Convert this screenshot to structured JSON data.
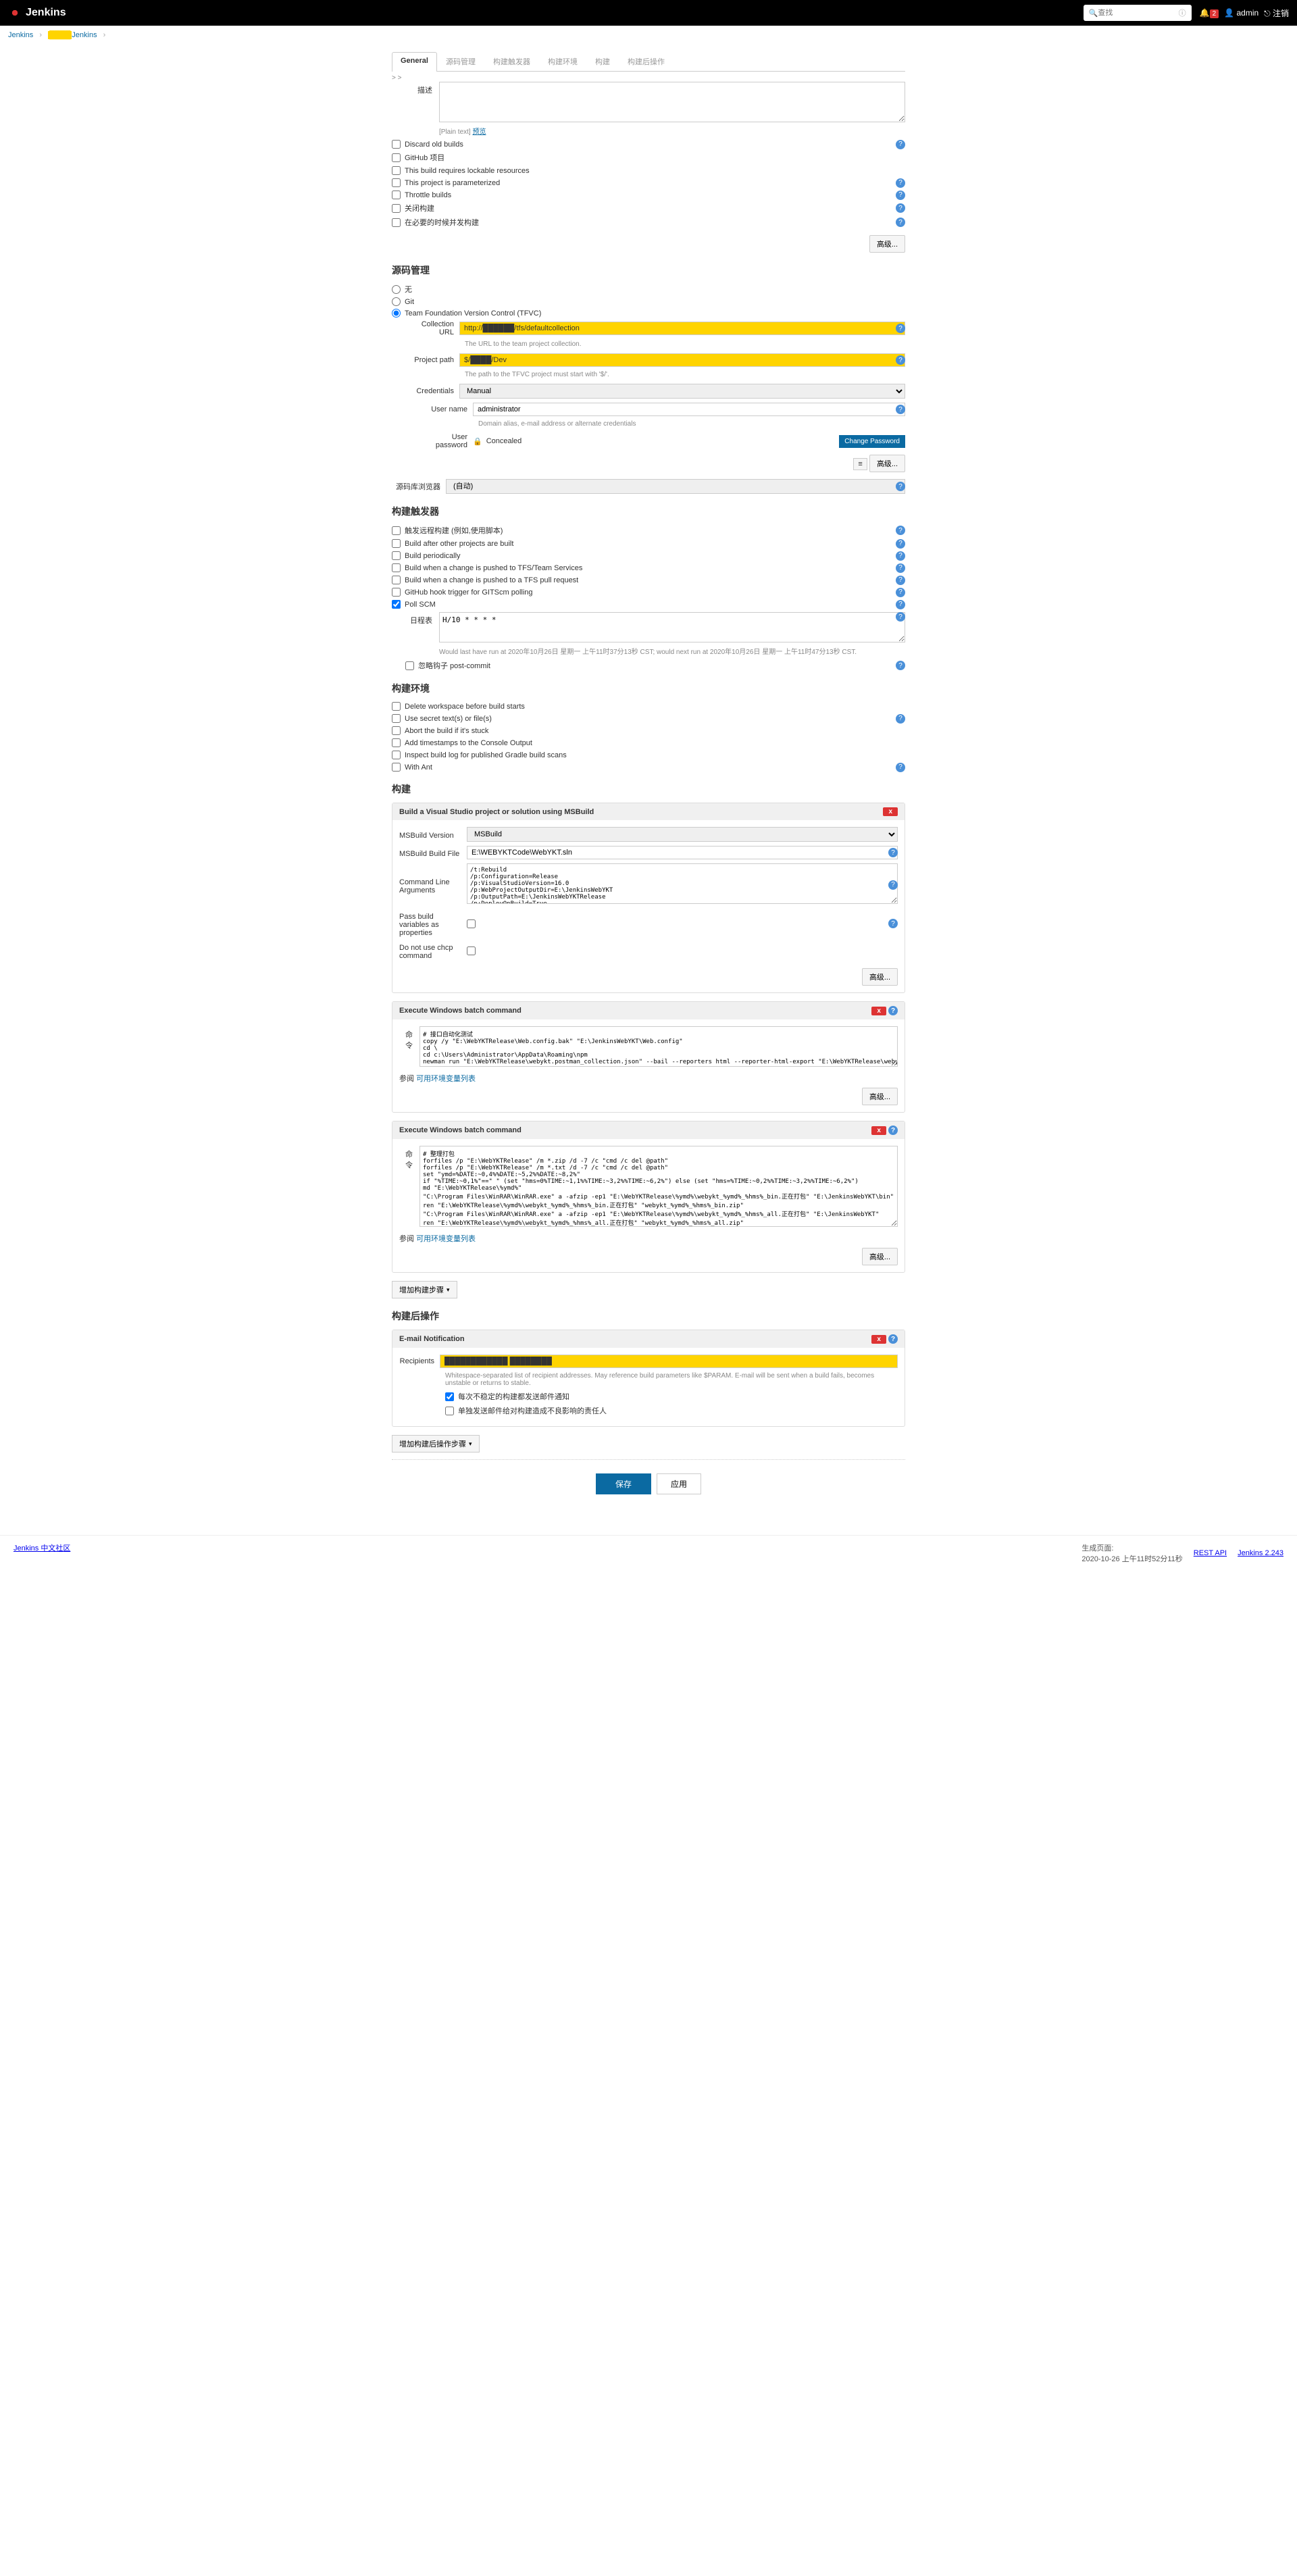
{
  "header": {
    "brand": "Jenkins",
    "search_placeholder": "查找",
    "bell_count": "2",
    "user": "admin",
    "logout": "注销"
  },
  "breadcrumbs": {
    "root": "Jenkins",
    "project_suffix": "Jenkins"
  },
  "tabs": [
    "General",
    "源码管理",
    "构建触发器",
    "构建环境",
    "构建",
    "构建后操作"
  ],
  "general": {
    "desc_label": "描述",
    "preview_prefix": "[Plain text]",
    "preview_link": "预览",
    "discard_old": "Discard old builds",
    "github_project": "GitHub 项目",
    "lockable": "This build requires lockable resources",
    "parameterized": "This project is parameterized",
    "throttle": "Throttle builds",
    "close_build": "关闭构建",
    "concurrent": "在必要的时候并发构建",
    "advanced": "高级..."
  },
  "scm": {
    "heading": "源码管理",
    "none": "无",
    "git": "Git",
    "tfvc": "Team Foundation Version Control (TFVC)",
    "collection_url_label": "Collection URL",
    "collection_url_prefix": "http://",
    "collection_url_suffix": "/tfs/defaultcollection",
    "collection_hint": "The URL to the team project collection.",
    "project_path_label": "Project path",
    "project_path_prefix": "$/",
    "project_path_suffix": "/Dev",
    "project_hint": "The path to the TFVC project must start with '$/'.",
    "credentials_label": "Credentials",
    "credentials_value": "Manual",
    "username_label": "User name",
    "username_value": "administrator",
    "username_hint": "Domain alias, e-mail address or alternate credentials",
    "password_label": "User password",
    "password_value": "Concealed",
    "change_password": "Change Password",
    "advanced": "高级...",
    "browser_label": "源码库浏览器",
    "browser_value": "(自动)"
  },
  "triggers": {
    "heading": "构建触发器",
    "remote": "触发远程构建 (例如,使用脚本)",
    "after_other": "Build after other projects are built",
    "periodically": "Build periodically",
    "tfs_push": "Build when a change is pushed to TFS/Team Services",
    "tfs_pr": "Build when a change is pushed to a TFS pull request",
    "github_hook": "GitHub hook trigger for GITScm polling",
    "poll_scm": "Poll SCM",
    "schedule_label": "日程表",
    "schedule_value": "H/10 * * * *",
    "schedule_hint": "Would last have run at 2020年10月26日 星期一 上午11时37分13秒 CST; would next run at 2020年10月26日 星期一 上午11时47分13秒 CST.",
    "ignore_hooks": "忽略钩子 post-commit"
  },
  "env": {
    "heading": "构建环境",
    "delete_ws": "Delete workspace before build starts",
    "secret": "Use secret text(s) or file(s)",
    "abort_stuck": "Abort the build if it's stuck",
    "timestamps": "Add timestamps to the Console Output",
    "gradle_scans": "Inspect build log for published Gradle build scans",
    "with_ant": "With Ant"
  },
  "build": {
    "heading": "构建",
    "msbuild_title": "Build a Visual Studio project or solution using MSBuild",
    "msbuild_version_label": "MSBuild Version",
    "msbuild_version": "MSBuild",
    "msbuild_file_label": "MSBuild Build File",
    "msbuild_file": "E:\\WEBYKTCode\\WebYKT.sln",
    "cmd_args_label": "Command Line Arguments",
    "cmd_args": "/t:Rebuild\n/p:Configuration=Release\n/p:VisualStudioVersion=16.0\n/p:WebProjectOutputDir=E:\\JenkinsWebYKT\n/p:OutputPath=E:\\JenkinsWebYKTRelease\n/p:DeployOnBuild=True",
    "pass_vars": "Pass build variables as properties",
    "no_chcp": "Do not use chcp command",
    "advanced": "高级...",
    "batch_title": "Execute Windows batch command",
    "cmd_label": "命令",
    "batch1": "# 接口自动化测试\ncopy /y \"E:\\WebYKTRelease\\Web.config.bak\" \"E:\\JenkinsWebYKT\\Web.config\"\ncd \\\ncd c:\\Users\\Administrator\\AppData\\Roaming\\npm\nnewman run \"E:\\WebYKTRelease\\webykt.postman_collection.json\" --bail --reporters html --reporter-html-export \"E:\\WebYKTRelease\\webykt_postman_report.html\"",
    "batch2": "# 整理打包\nforfiles /p \"E:\\WebYKTRelease\" /m *.zip /d -7 /c \"cmd /c del @path\"\nforfiles /p \"E:\\WebYKTRelease\" /m *.txt /d -7 /c \"cmd /c del @path\"\nset \"ymd=%DATE:~0,4%%DATE:~5,2%%DATE:~8,2%\"\nif \"%TIME:~0,1%\"==\" \" (set \"hms=0%TIME:~1,1%%TIME:~3,2%%TIME:~6,2%\") else (set \"hms=%TIME:~0,2%%TIME:~3,2%%TIME:~6,2%\")\nmd \"E:\\WebYKTRelease\\%ymd%\"\n\"C:\\Program Files\\WinRAR\\WinRAR.exe\" a -afzip -ep1 \"E:\\WebYKTRelease\\%ymd%\\webykt_%ymd%_%hms%_bin.正在打包\" \"E:\\JenkinsWebYKT\\bin\"\nren \"E:\\WebYKTRelease\\%ymd%\\webykt_%ymd%_%hms%_bin.正在打包\" \"webykt_%ymd%_%hms%_bin.zip\"\n\"C:\\Program Files\\WinRAR\\WinRAR.exe\" a -afzip -ep1 \"E:\\WebYKTRelease\\%ymd%\\webykt_%ymd%_%hms%_all.正在打包\" \"E:\\JenkinsWebYKT\"\nren \"E:\\WebYKTRelease\\%ymd%\\webykt_%ymd%_%hms%_all.正在打包\" \"webykt_%ymd%_%hms%_all.zip\"\ndel /s /q \"E:\\WebYKTRelease\\webykt_bin_latest.打包完成.txt\"\ncopy \"E:\\WebYKTRelease\\%ymd%\\webykt_%ymd%_%hms%_bin.zip\" \"E:\\WebYKTRelease\\webykt_bin_latest.zip\"\necho 最新webykt_%ymd%_%hms%_bin打包完成>\"E:\\WebYKTRelease\\webykt_bin_latest_打包完成.txt\"\ndel /s /q \"E:\\WebYKTRelease\\webykt_all_latest.打包完成.txt\"\ncopy /y \"E:\\WebYKTRelease\\%ymd%\\webykt_%ymd%_%hms%_all.zip\" \"E:\\WebYKTRelease\\webykt_all_latest.zip\"\necho 最新webykt_%ymd%_%hms%_all打包完成>\"E:\\WebYKTRelease\\webykt_all_latest_打包完成.txt\"",
    "see_vars": "参阅",
    "see_vars_link": "可用环境变量列表",
    "add_step": "增加构建步骤"
  },
  "post": {
    "heading": "构建后操作",
    "email_title": "E-mail Notification",
    "recipients_label": "Recipients",
    "recipients_hint": "Whitespace-separated list of recipient addresses. May reference build parameters like $PARAM. E-mail will be sent when a build fails, becomes unstable or returns to stable.",
    "every_unstable": "每次不稳定的构建都发送邮件通知",
    "individuals": "单独发送邮件给对构建造成不良影响的责任人",
    "add_action": "增加构建后操作步骤"
  },
  "save": "保存",
  "apply": "应用",
  "footer": {
    "community": "Jenkins 中文社区",
    "gen_label": "生成页面:",
    "gen_time": "2020-10-26 上午11时52分11秒",
    "rest": "REST API",
    "version": "Jenkins 2.243"
  }
}
